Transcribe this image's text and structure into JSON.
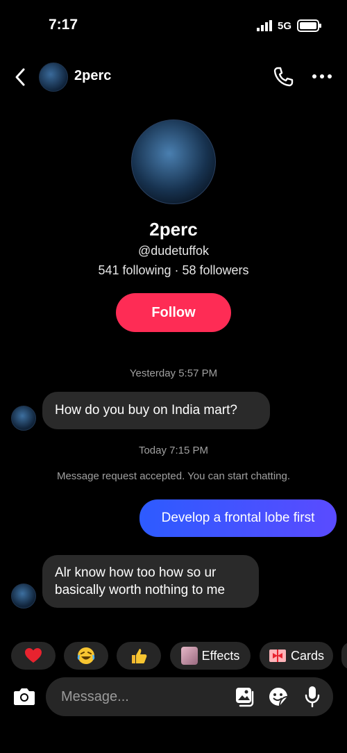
{
  "status": {
    "time": "7:17",
    "network": "5G"
  },
  "header": {
    "name": "2perc"
  },
  "profile": {
    "name": "2perc",
    "handle": "@dudetuffok",
    "stats": "541 following · 58 followers",
    "follow_label": "Follow"
  },
  "messages": [
    {
      "timestamp": "Yesterday 5:57 PM"
    },
    {
      "text": "How do you buy on India mart?"
    },
    {
      "timestamp": "Today 7:15 PM"
    },
    {
      "system": "Message request accepted. You can start chatting."
    },
    {
      "text": "Develop a frontal lobe first"
    },
    {
      "line1": "Alr know how too how so ur",
      "line2": "basically worth nothing to me"
    }
  ],
  "chips": {
    "effects": "Effects",
    "cards": "Cards"
  },
  "composer": {
    "placeholder": "Message..."
  },
  "colors": {
    "follow": "#fe2c55",
    "outgoing_bubble": "#3d56ff",
    "incoming_bubble": "#2a2a2a"
  }
}
